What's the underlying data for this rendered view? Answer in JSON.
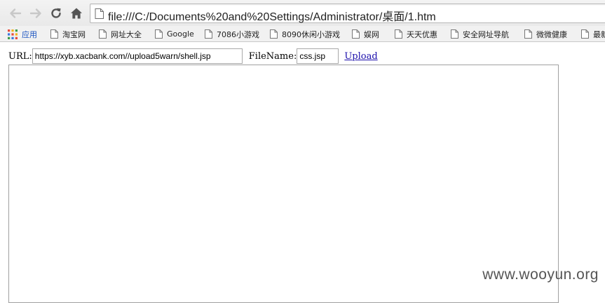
{
  "browser": {
    "address": "file:///C:/Documents%20and%20Settings/Administrator/桌面/1.htm",
    "icons": [
      "back-arrow-icon",
      "forward-arrow-icon",
      "reload-icon",
      "home-icon",
      "page-icon"
    ]
  },
  "bookmarks": {
    "apps_label": "应用",
    "items": [
      {
        "label": "淘宝网"
      },
      {
        "label": "网址大全"
      },
      {
        "label": "Google"
      },
      {
        "label": "7086小游戏"
      },
      {
        "label": "8090休闲小游戏"
      },
      {
        "label": "娱网"
      },
      {
        "label": "天天优惠"
      },
      {
        "label": "安全网址导航"
      },
      {
        "label": "微微健康"
      },
      {
        "label": "最新"
      }
    ]
  },
  "form": {
    "url_label": "URL:",
    "url_value": "https://xyb.xacbank.com//upload5warn/shell.jsp",
    "filename_label": "FileName:",
    "filename_value": "css.jsp",
    "upload_label": "Upload"
  },
  "watermark": "www.wooyun.org",
  "colors": {
    "link": "#1a0dab",
    "apps_label": "#1a53c1"
  }
}
